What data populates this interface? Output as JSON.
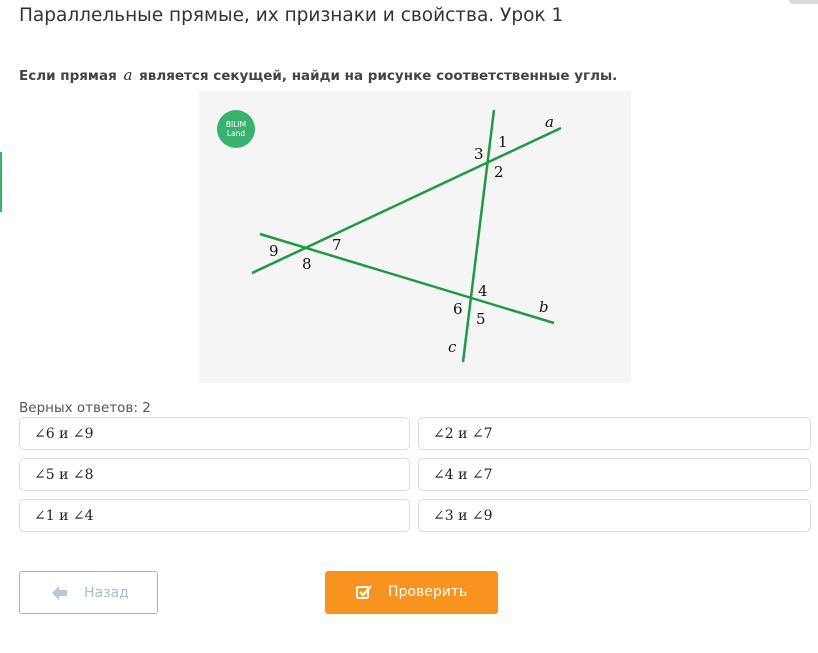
{
  "page": {
    "title": "Параллельные прямые, их признаки и свойства. Урок 1"
  },
  "question": {
    "prefix": "Если прямая",
    "variable": "a",
    "suffix": "является секущей, найди на рисунке соответственные углы."
  },
  "figure": {
    "logo": {
      "line1": "BILIM",
      "line2": "Land",
      "color": "#3ab26f"
    },
    "line_color": "#1f9a40",
    "line_labels": {
      "a": "a",
      "b": "b",
      "c": "c"
    },
    "angle_labels": [
      "1",
      "2",
      "3",
      "4",
      "5",
      "6",
      "7",
      "8",
      "9"
    ]
  },
  "answers": {
    "count_text": "Верных ответов: 2",
    "options": [
      {
        "text": "∠6 и ∠9"
      },
      {
        "text": "∠2 и ∠7"
      },
      {
        "text": "∠5 и ∠8"
      },
      {
        "text": "∠4 и ∠7"
      },
      {
        "text": "∠1 и ∠4"
      },
      {
        "text": "∠3 и ∠9"
      }
    ]
  },
  "buttons": {
    "back_label": "Назад",
    "check_label": "Проверить",
    "back_icon": "arrow-left-icon",
    "check_icon": "checkbox-icon",
    "check_color": "#f7931e"
  }
}
